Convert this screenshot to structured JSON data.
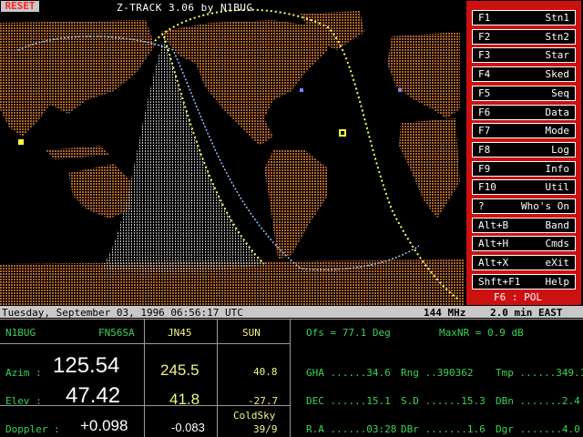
{
  "app": {
    "title": "Z-TRACK 3.06 by N1BUG",
    "reset_label": "RESET"
  },
  "menu": {
    "items": [
      {
        "key": "F1",
        "label": "Stn1"
      },
      {
        "key": "F2",
        "label": "Stn2"
      },
      {
        "key": "F3",
        "label": "Star"
      },
      {
        "key": "F4",
        "label": "Sked"
      },
      {
        "key": "F5",
        "label": "Seq"
      },
      {
        "key": "F6",
        "label": "Data"
      },
      {
        "key": "F7",
        "label": "Mode"
      },
      {
        "key": "F8",
        "label": "Log"
      },
      {
        "key": "F9",
        "label": "Info"
      },
      {
        "key": "F10",
        "label": "Util"
      },
      {
        "key": "?",
        "label": "Who's On"
      },
      {
        "key": "Alt+B",
        "label": "Band"
      },
      {
        "key": "Alt+H",
        "label": "Cmds"
      },
      {
        "key": "Alt+X",
        "label": "eXit"
      },
      {
        "key": "Shft+F1",
        "label": "Help"
      }
    ],
    "mode_status": "F6 : POL"
  },
  "status": {
    "datetime": "Tuesday, September 03, 1996 06:56:17 UTC",
    "band": "144 MHz",
    "step": "2.0 min EAST"
  },
  "stations": {
    "call": "N1BUG",
    "grid1": "FN56SA",
    "grid2": "JN45",
    "target": "SUN",
    "azim_label": "Azim :",
    "azim_val": "125.54",
    "azim_val2": "245.5",
    "azim_sun": "40.8",
    "elev_label": "Elev :",
    "elev_val": "47.42",
    "elev_val2": "41.8",
    "elev_sun": "-27.7",
    "sky_label": "ColdSky",
    "doppler_label": "Doppler :",
    "doppler_val": "+0.098",
    "doppler_val2": "-0.083",
    "sky_val": "39/9"
  },
  "data_panel": {
    "ofs": "Ofs = 77.1 Deg",
    "maxnr": "MaxNR = 0.9 dB",
    "row1": {
      "a": "GHA ......34.6",
      "b": "Rng ..390362",
      "c": "Tmp ......349.1"
    },
    "row2": {
      "a": "DEC ......15.1",
      "b": "S.D ......15.3",
      "c": "DBn .......2.4"
    },
    "row3": {
      "a": "R.A ......03:28",
      "b": "DBr .......1.6",
      "c": "Dgr .......4.0"
    }
  },
  "colors": {
    "land": "#b5652a",
    "menu_bg": "#cc1111",
    "status_bg": "#c8c8c8",
    "green": "#39d353",
    "yellow": "#f3f38a"
  }
}
